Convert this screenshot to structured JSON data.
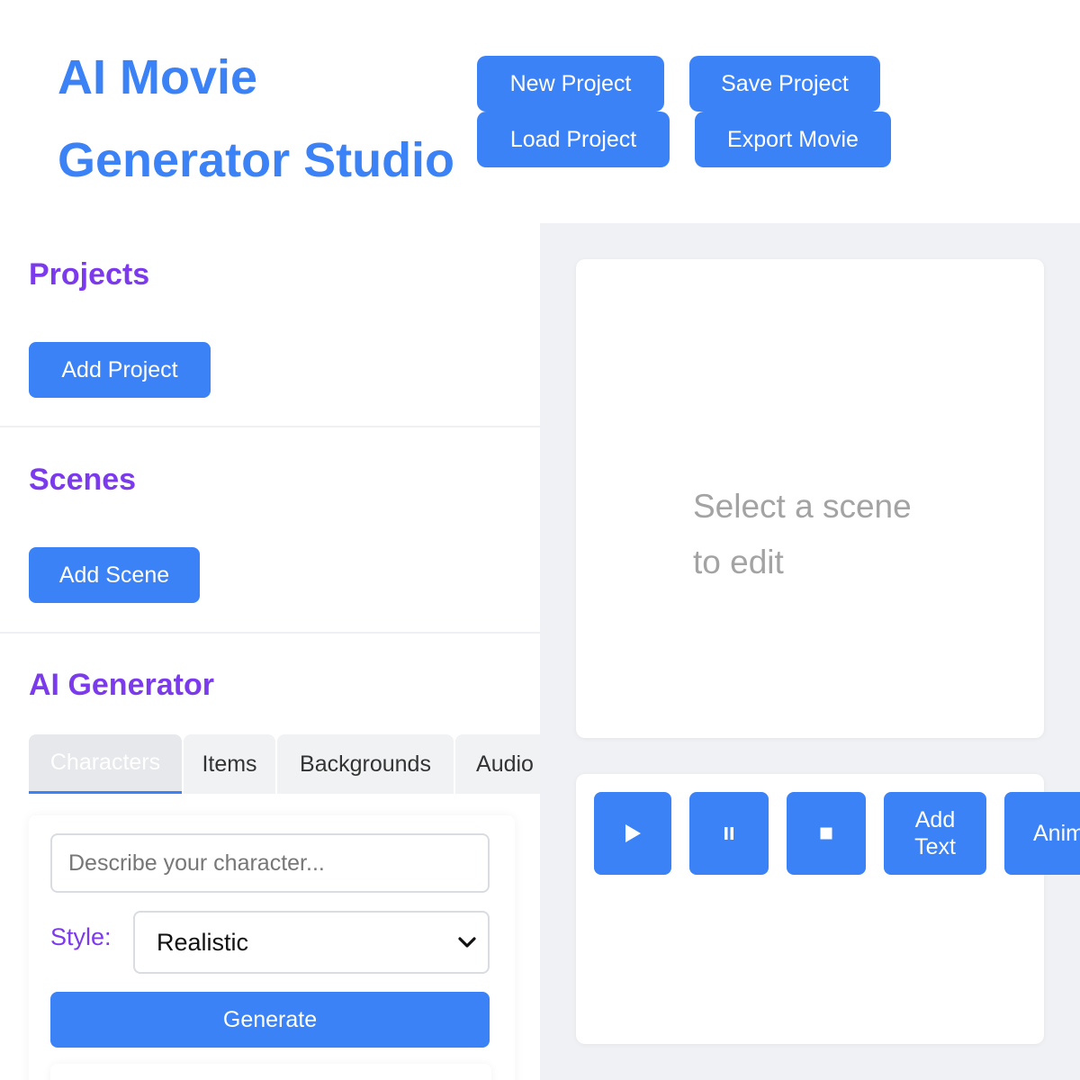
{
  "header": {
    "title": "AI Movie Generator Studio",
    "buttons": {
      "new_project": "New Project",
      "save_project": "Save Project",
      "load_project": "Load Project",
      "export_movie": "Export Movie"
    }
  },
  "sidebar": {
    "projects": {
      "title": "Projects",
      "add_button": "Add Project"
    },
    "scenes": {
      "title": "Scenes",
      "add_button": "Add Scene"
    },
    "generator": {
      "title": "AI Generator",
      "tabs": [
        "Characters",
        "Items",
        "Backgrounds",
        "Audio"
      ],
      "active_tab": "Characters",
      "prompt_placeholder": "Describe your character...",
      "prompt_value": "",
      "style_label": "Style:",
      "style_selected": "Realistic",
      "generate_button": "Generate"
    }
  },
  "preview": {
    "placeholder": "Select a scene to edit"
  },
  "controls": {
    "play_icon": "play-icon",
    "pause_icon": "pause-icon",
    "stop_icon": "stop-icon",
    "add_text": "Add Text",
    "animate": "Animate"
  },
  "colors": {
    "accent": "#3b82f6",
    "heading": "#7c3aed",
    "panel_bg": "#f0f1f4"
  }
}
